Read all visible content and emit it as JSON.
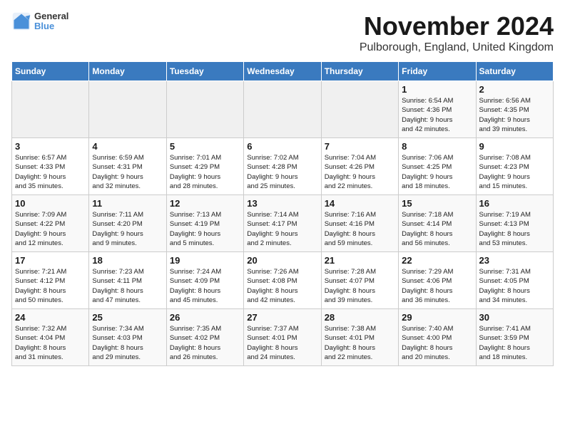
{
  "logo": {
    "line1": "General",
    "line2": "Blue"
  },
  "title": "November 2024",
  "location": "Pulborough, England, United Kingdom",
  "days_of_week": [
    "Sunday",
    "Monday",
    "Tuesday",
    "Wednesday",
    "Thursday",
    "Friday",
    "Saturday"
  ],
  "weeks": [
    [
      {
        "day": "",
        "info": ""
      },
      {
        "day": "",
        "info": ""
      },
      {
        "day": "",
        "info": ""
      },
      {
        "day": "",
        "info": ""
      },
      {
        "day": "",
        "info": ""
      },
      {
        "day": "1",
        "info": "Sunrise: 6:54 AM\nSunset: 4:36 PM\nDaylight: 9 hours\nand 42 minutes."
      },
      {
        "day": "2",
        "info": "Sunrise: 6:56 AM\nSunset: 4:35 PM\nDaylight: 9 hours\nand 39 minutes."
      }
    ],
    [
      {
        "day": "3",
        "info": "Sunrise: 6:57 AM\nSunset: 4:33 PM\nDaylight: 9 hours\nand 35 minutes."
      },
      {
        "day": "4",
        "info": "Sunrise: 6:59 AM\nSunset: 4:31 PM\nDaylight: 9 hours\nand 32 minutes."
      },
      {
        "day": "5",
        "info": "Sunrise: 7:01 AM\nSunset: 4:29 PM\nDaylight: 9 hours\nand 28 minutes."
      },
      {
        "day": "6",
        "info": "Sunrise: 7:02 AM\nSunset: 4:28 PM\nDaylight: 9 hours\nand 25 minutes."
      },
      {
        "day": "7",
        "info": "Sunrise: 7:04 AM\nSunset: 4:26 PM\nDaylight: 9 hours\nand 22 minutes."
      },
      {
        "day": "8",
        "info": "Sunrise: 7:06 AM\nSunset: 4:25 PM\nDaylight: 9 hours\nand 18 minutes."
      },
      {
        "day": "9",
        "info": "Sunrise: 7:08 AM\nSunset: 4:23 PM\nDaylight: 9 hours\nand 15 minutes."
      }
    ],
    [
      {
        "day": "10",
        "info": "Sunrise: 7:09 AM\nSunset: 4:22 PM\nDaylight: 9 hours\nand 12 minutes."
      },
      {
        "day": "11",
        "info": "Sunrise: 7:11 AM\nSunset: 4:20 PM\nDaylight: 9 hours\nand 9 minutes."
      },
      {
        "day": "12",
        "info": "Sunrise: 7:13 AM\nSunset: 4:19 PM\nDaylight: 9 hours\nand 5 minutes."
      },
      {
        "day": "13",
        "info": "Sunrise: 7:14 AM\nSunset: 4:17 PM\nDaylight: 9 hours\nand 2 minutes."
      },
      {
        "day": "14",
        "info": "Sunrise: 7:16 AM\nSunset: 4:16 PM\nDaylight: 8 hours\nand 59 minutes."
      },
      {
        "day": "15",
        "info": "Sunrise: 7:18 AM\nSunset: 4:14 PM\nDaylight: 8 hours\nand 56 minutes."
      },
      {
        "day": "16",
        "info": "Sunrise: 7:19 AM\nSunset: 4:13 PM\nDaylight: 8 hours\nand 53 minutes."
      }
    ],
    [
      {
        "day": "17",
        "info": "Sunrise: 7:21 AM\nSunset: 4:12 PM\nDaylight: 8 hours\nand 50 minutes."
      },
      {
        "day": "18",
        "info": "Sunrise: 7:23 AM\nSunset: 4:11 PM\nDaylight: 8 hours\nand 47 minutes."
      },
      {
        "day": "19",
        "info": "Sunrise: 7:24 AM\nSunset: 4:09 PM\nDaylight: 8 hours\nand 45 minutes."
      },
      {
        "day": "20",
        "info": "Sunrise: 7:26 AM\nSunset: 4:08 PM\nDaylight: 8 hours\nand 42 minutes."
      },
      {
        "day": "21",
        "info": "Sunrise: 7:28 AM\nSunset: 4:07 PM\nDaylight: 8 hours\nand 39 minutes."
      },
      {
        "day": "22",
        "info": "Sunrise: 7:29 AM\nSunset: 4:06 PM\nDaylight: 8 hours\nand 36 minutes."
      },
      {
        "day": "23",
        "info": "Sunrise: 7:31 AM\nSunset: 4:05 PM\nDaylight: 8 hours\nand 34 minutes."
      }
    ],
    [
      {
        "day": "24",
        "info": "Sunrise: 7:32 AM\nSunset: 4:04 PM\nDaylight: 8 hours\nand 31 minutes."
      },
      {
        "day": "25",
        "info": "Sunrise: 7:34 AM\nSunset: 4:03 PM\nDaylight: 8 hours\nand 29 minutes."
      },
      {
        "day": "26",
        "info": "Sunrise: 7:35 AM\nSunset: 4:02 PM\nDaylight: 8 hours\nand 26 minutes."
      },
      {
        "day": "27",
        "info": "Sunrise: 7:37 AM\nSunset: 4:01 PM\nDaylight: 8 hours\nand 24 minutes."
      },
      {
        "day": "28",
        "info": "Sunrise: 7:38 AM\nSunset: 4:01 PM\nDaylight: 8 hours\nand 22 minutes."
      },
      {
        "day": "29",
        "info": "Sunrise: 7:40 AM\nSunset: 4:00 PM\nDaylight: 8 hours\nand 20 minutes."
      },
      {
        "day": "30",
        "info": "Sunrise: 7:41 AM\nSunset: 3:59 PM\nDaylight: 8 hours\nand 18 minutes."
      }
    ]
  ]
}
